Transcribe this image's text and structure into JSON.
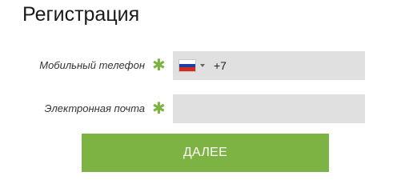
{
  "page": {
    "title": "Регистрация"
  },
  "form": {
    "phone": {
      "label": "Мобильный телефон",
      "required_mark": "✱",
      "country": "Russia",
      "dial_code": "+7",
      "value": ""
    },
    "email": {
      "label": "Электронная почта",
      "required_mark": "✱",
      "value": ""
    },
    "submit_label": "ДАЛЕЕ"
  },
  "colors": {
    "accent": "#7cb342",
    "input_bg": "#e0e0e0",
    "text": "#1a1a1a"
  },
  "icons": {
    "country_flag": "russia-flag-icon",
    "dropdown": "caret-down-icon",
    "required": "asterisk-icon"
  }
}
